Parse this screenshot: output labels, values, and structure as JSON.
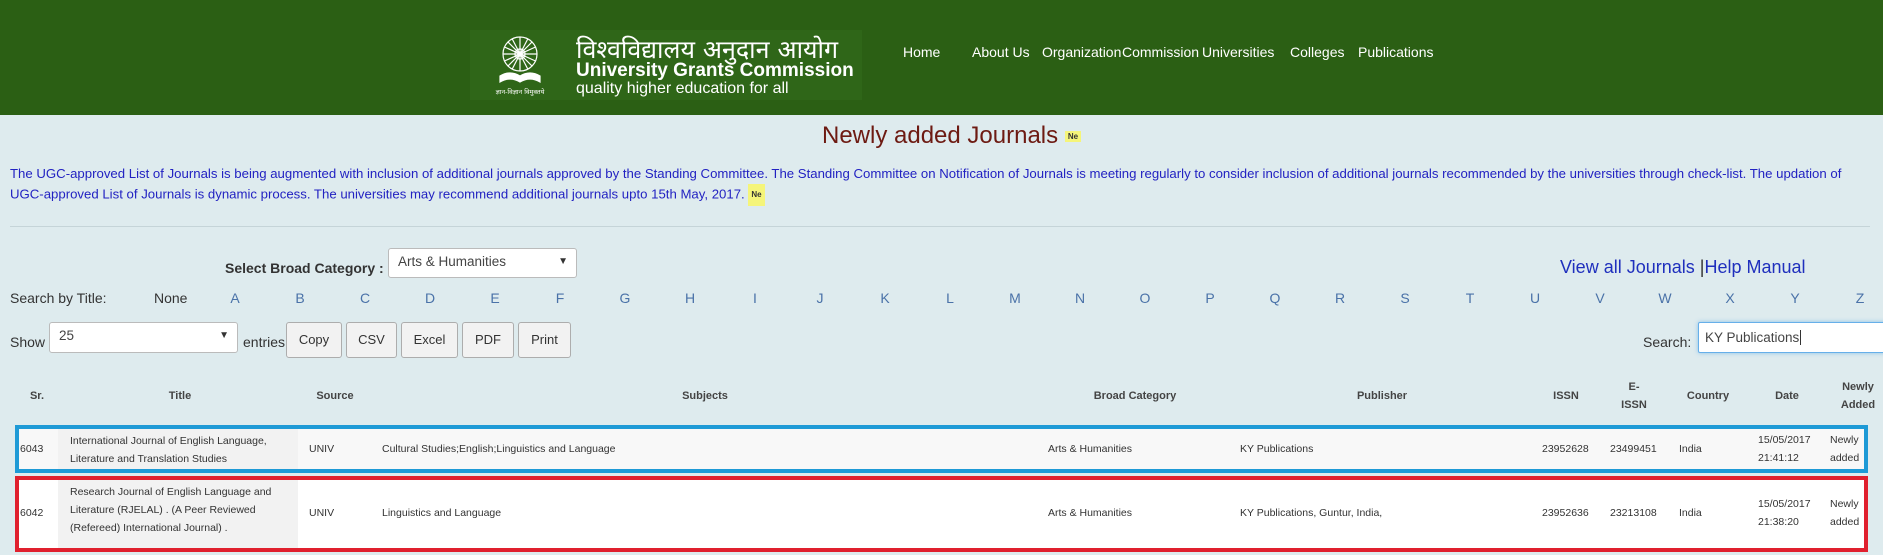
{
  "header": {
    "logo_hindi": "विश्वविद्यालय अनुदान आयोग",
    "logo_english": "University Grants Commission",
    "logo_tagline": "quality higher education for all",
    "emblem_caption": "ज्ञान-विज्ञान विमुक्तये",
    "nav": [
      "Home",
      "About Us",
      "Organization",
      "Commission",
      "Universities",
      "Colleges",
      "Publications"
    ]
  },
  "page": {
    "title": "Newly added Journals",
    "new_badge": "Ne",
    "intro_text": "The UGC-approved List of Journals is being augmented with inclusion of additional journals approved by the Standing Committee. The Standing Committee on Notification of Journals is meeting regularly to consider inclusion of additional journals recommended by the universities through check-list. The updation of UGC-approved List of Journals is dynamic process. The universities may recommend additional journals upto 15th May, 2017."
  },
  "filters": {
    "category_label": "Select Broad Category :",
    "category_value": "Arts & Humanities",
    "view_all_link": "View all Journals",
    "link_separator": "|",
    "help_link": "Help Manual",
    "search_by_title_label": "Search by Title:",
    "none_option": "None",
    "letters": [
      "A",
      "B",
      "C",
      "D",
      "E",
      "F",
      "G",
      "H",
      "I",
      "J",
      "K",
      "L",
      "M",
      "N",
      "O",
      "P",
      "Q",
      "R",
      "S",
      "T",
      "U",
      "V",
      "W",
      "X",
      "Y",
      "Z"
    ]
  },
  "table_controls": {
    "show_label": "Show",
    "page_size": "25",
    "entries_label": "entries",
    "buttons": [
      "Copy",
      "CSV",
      "Excel",
      "PDF",
      "Print"
    ],
    "search_label": "Search:",
    "search_value": "KY Publications"
  },
  "table": {
    "headers": {
      "sr": "Sr.",
      "title": "Title",
      "source": "Source",
      "subjects": "Subjects",
      "broad_category": "Broad Category",
      "publisher": "Publisher",
      "issn": "ISSN",
      "eissn_1": "E-",
      "eissn_2": "ISSN",
      "country": "Country",
      "date": "Date",
      "newly_1": "Newly",
      "newly_2": "Added"
    },
    "rows": [
      {
        "sr": "6043",
        "title_lines": [
          "International Journal of English Language,",
          "Literature and Translation Studies"
        ],
        "source": "UNIV",
        "subjects": "Cultural Studies;English;Linguistics and Language",
        "broad_category": "Arts & Humanities",
        "publisher": "KY Publications",
        "issn": "23952628",
        "eissn": "23499451",
        "country": "India",
        "date_lines": [
          "15/05/2017",
          "21:41:12"
        ],
        "newly_lines": [
          "Newly",
          "added"
        ]
      },
      {
        "sr": "6042",
        "title_lines": [
          "Research Journal of English Language and",
          "Literature (RJELAL) . (A Peer Reviewed",
          "(Refereed) International Journal) ."
        ],
        "source": "UNIV",
        "subjects": "Linguistics and Language",
        "broad_category": "Arts & Humanities",
        "publisher": "KY Publications, Guntur, India,",
        "issn": "23952636",
        "eissn": "23213108",
        "country": "India",
        "date_lines": [
          "15/05/2017",
          "21:38:20"
        ],
        "newly_lines": [
          "Newly",
          "added"
        ]
      }
    ],
    "highlight_colors": {
      "row1": "#1e9ad6",
      "row2": "#e0202e"
    }
  },
  "colors": {
    "header_green": "#2b5f14",
    "page_bg": "#deebee",
    "title_color": "#6d1a12",
    "intro_color": "#2222c2",
    "link_color": "#1f2fbd"
  }
}
